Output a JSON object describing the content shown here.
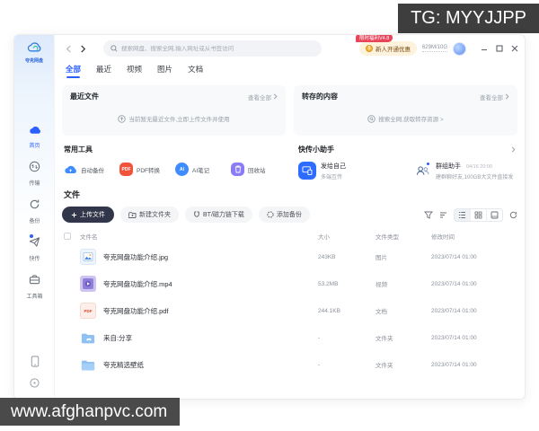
{
  "watermarks": {
    "top_right": "TG: MYYJJPP",
    "bottom_left": "www.afghanpvc.com"
  },
  "logo_text": "夸克网盘",
  "topbar": {
    "search_placeholder": "搜索网盘、搜索全网,输入网址或从书签访问",
    "promo_badge": "限时福利V4.8",
    "promo_label": "新人开通优惠",
    "storage": "629M/10G"
  },
  "tabs": [
    {
      "label": "全部"
    },
    {
      "label": "最近"
    },
    {
      "label": "视频"
    },
    {
      "label": "图片"
    },
    {
      "label": "文档"
    }
  ],
  "sidebar": {
    "items": [
      {
        "label": "首页"
      },
      {
        "label": "传输"
      },
      {
        "label": "备份"
      },
      {
        "label": "快传"
      },
      {
        "label": "工具箱"
      }
    ]
  },
  "recent": {
    "title": "最近文件",
    "view_all": "查看全部",
    "empty": "当前暂无最近文件,立即上传文件并使用"
  },
  "saved": {
    "title": "转存的内容",
    "view_all": "查看全部",
    "empty": "搜索全网,获取转存资源 >"
  },
  "tools": {
    "title": "常用工具",
    "items": [
      {
        "label": "自动备份"
      },
      {
        "label": "PDF转换"
      },
      {
        "label": "AI笔记"
      },
      {
        "label": "回收站"
      }
    ]
  },
  "quick": {
    "title": "快传小助手",
    "items": [
      {
        "title": "发给自己",
        "subtitle": "多端互传"
      },
      {
        "title": "群组助手",
        "time": "04/16 20:00",
        "subtitle": "建群聊好友,100GB大文件直接发"
      }
    ]
  },
  "files": {
    "title": "文件",
    "upload_button": "上传文件",
    "new_folder_button": "新建文件夹",
    "bt_button": "BT/磁力链下载",
    "backup_button": "添加备份",
    "columns": {
      "name": "文件名",
      "size": "大小",
      "type": "文件类型",
      "modified": "修改时间"
    },
    "rows": [
      {
        "name": "夸克网盘功能介绍.jpg",
        "size": "243KB",
        "type": "图片",
        "time": "2023/07/14 01:00"
      },
      {
        "name": "夸克网盘功能介绍.mp4",
        "size": "53.2MB",
        "type": "视频",
        "time": "2023/07/14 01:00"
      },
      {
        "name": "夸克网盘功能介绍.pdf",
        "size": "244.1KB",
        "type": "文档",
        "time": "2023/07/14 01:00"
      },
      {
        "name": "来自:分享",
        "size": "-",
        "type": "文件夹",
        "time": "2023/07/14 01:00"
      },
      {
        "name": "夸克精选壁纸",
        "size": "-",
        "type": "文件夹",
        "time": "2023/07/14 01:00"
      }
    ]
  },
  "colors": {
    "accent": "#2b5fff",
    "pdf_red": "#f0533a",
    "trash_purple": "#8b7bf4",
    "badge_red": "#e8455a"
  }
}
